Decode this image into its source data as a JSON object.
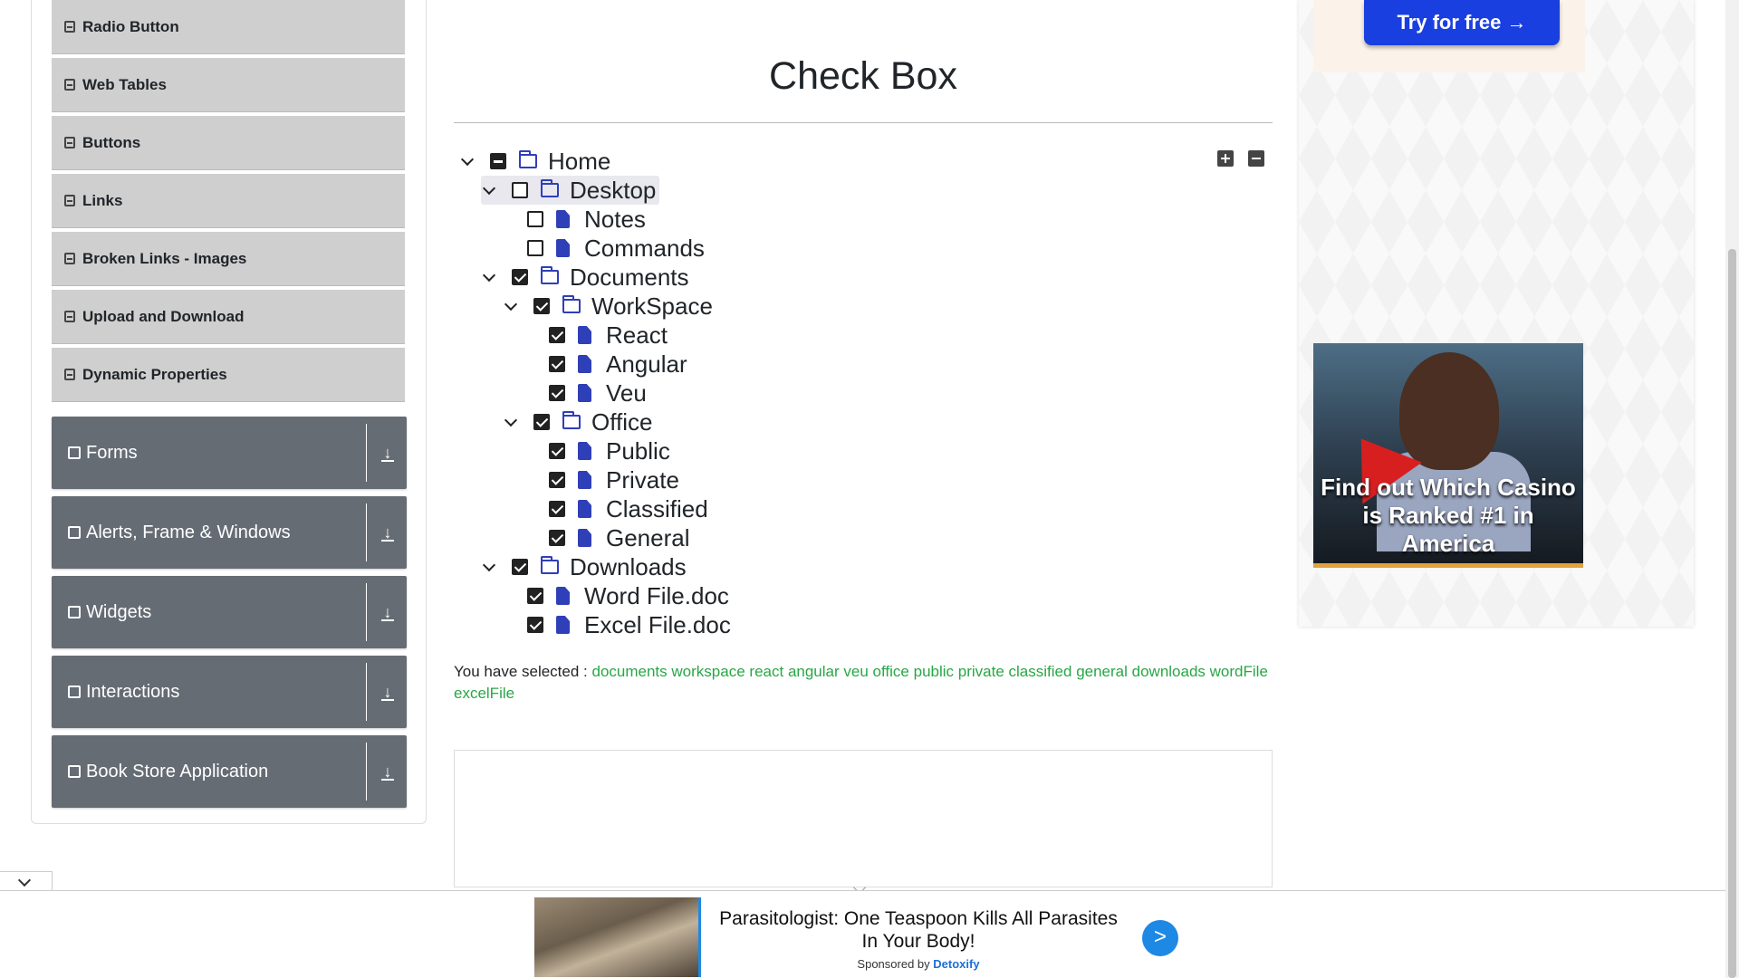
{
  "sidebar": {
    "items": [
      {
        "label": "Radio Button"
      },
      {
        "label": "Web Tables"
      },
      {
        "label": "Buttons"
      },
      {
        "label": "Links"
      },
      {
        "label": "Broken Links - Images"
      },
      {
        "label": "Upload and Download"
      },
      {
        "label": "Dynamic Properties"
      }
    ],
    "groups": [
      {
        "label": "Forms"
      },
      {
        "label": "Alerts, Frame & Windows"
      },
      {
        "label": "Widgets"
      },
      {
        "label": "Interactions"
      },
      {
        "label": "Book Store Application"
      }
    ]
  },
  "main": {
    "title": "Check Box",
    "tree": {
      "home": "Home",
      "desktop": "Desktop",
      "notes": "Notes",
      "commands": "Commands",
      "documents": "Documents",
      "workspace": "WorkSpace",
      "react": "React",
      "angular": "Angular",
      "veu": "Veu",
      "office": "Office",
      "public": "Public",
      "private": "Private",
      "classified": "Classified",
      "general": "General",
      "downloads": "Downloads",
      "word": "Word File.doc",
      "excel": "Excel File.doc"
    },
    "result_label": "You have selected :",
    "selected": [
      "documents",
      "workspace",
      "react",
      "angular",
      "veu",
      "office",
      "public",
      "private",
      "classified",
      "general",
      "downloads",
      "wordFile",
      "excelFile"
    ]
  },
  "ads": {
    "try_button": "Try for free →",
    "casino_text": "Find out Which Casino is Ranked #1 in America",
    "bottom": {
      "title": "Parasitologist: One Teaspoon Kills All Parasites In Your Body!",
      "sponsored_label": "Sponsored by",
      "sponsor": "Detoxify",
      "go": ">"
    }
  },
  "colors": {
    "accent_icon": "#2f3fb8",
    "selected_text": "#28a745",
    "group_bg": "#666c74"
  }
}
